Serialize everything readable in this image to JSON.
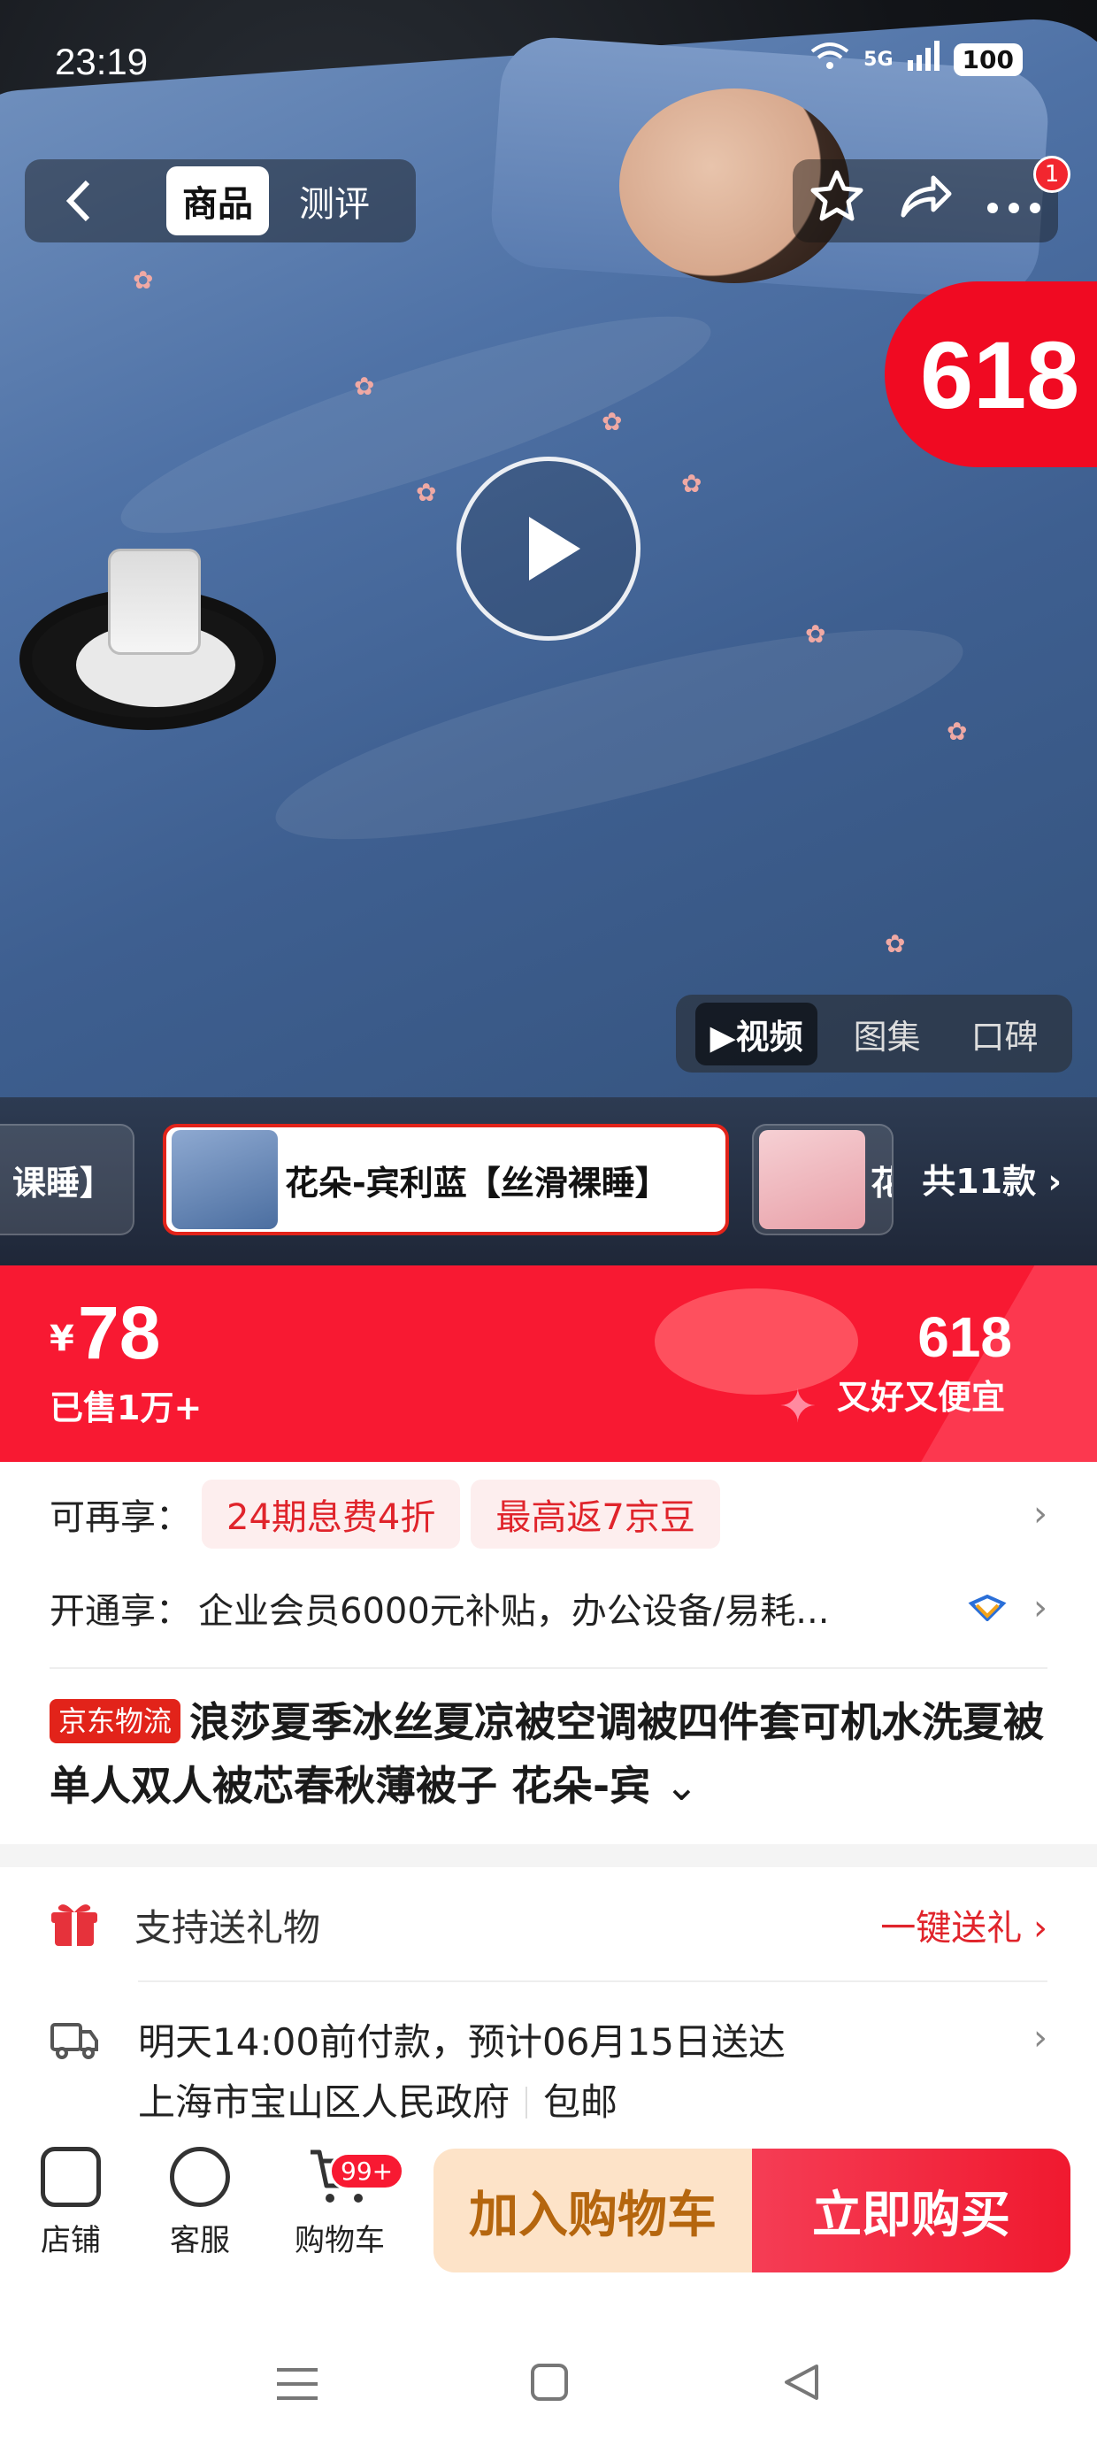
{
  "status_bar": {
    "time": "23:19",
    "network": "5G",
    "battery": "100"
  },
  "header": {
    "back_icon": "chevron-left-icon",
    "tabs": [
      {
        "label": "商品",
        "active": true
      },
      {
        "label": "测评",
        "active": false
      }
    ],
    "actions": [
      "star-icon",
      "share-icon",
      "more-icon"
    ],
    "notification_count": "1"
  },
  "hero": {
    "promo_badge": "618",
    "media_tabs": [
      {
        "label": "▶视频",
        "active": true
      },
      {
        "label": "图集",
        "active": false
      },
      {
        "label": "口碑",
        "active": false
      }
    ]
  },
  "variants": {
    "items": [
      {
        "label": "课睡】"
      },
      {
        "label": "花朵-宾利蓝【丝滑裸睡】",
        "selected": true
      },
      {
        "label": "花"
      }
    ],
    "count_label": "共11款 ›"
  },
  "price_banner": {
    "currency": "¥",
    "price": "78",
    "sold": "已售1万+",
    "promo_event": "618",
    "promo_slogan": "又好又便宜"
  },
  "benefits": {
    "extra_label": "可再享：",
    "extra_pills": [
      "24期息费4折",
      "最高返7京豆"
    ],
    "member_label": "开通享：",
    "member_text": "企业会员6000元补贴，办公设备/易耗..."
  },
  "product": {
    "logistics_tag": "京东物流",
    "title": "浪莎夏季冰丝夏凉被空调被四件套可机水洗夏被单人双人被芯春秋薄被子 花朵-宾"
  },
  "gift": {
    "label": "支持送礼物",
    "link": "一键送礼 ›"
  },
  "delivery": {
    "line1": "明天14:00前付款，预计06月15日送达",
    "address": "上海市宝山区人民政府",
    "shipping": "包邮"
  },
  "bottom_bar": {
    "store": "店铺",
    "service": "客服",
    "cart": "购物车",
    "cart_badge": "99+",
    "add_to_cart": "加入购物车",
    "buy_now": "立即购买"
  },
  "colors": {
    "accent": "#f81932",
    "cart_button": "#fde3c8",
    "link": "#e0242b"
  }
}
